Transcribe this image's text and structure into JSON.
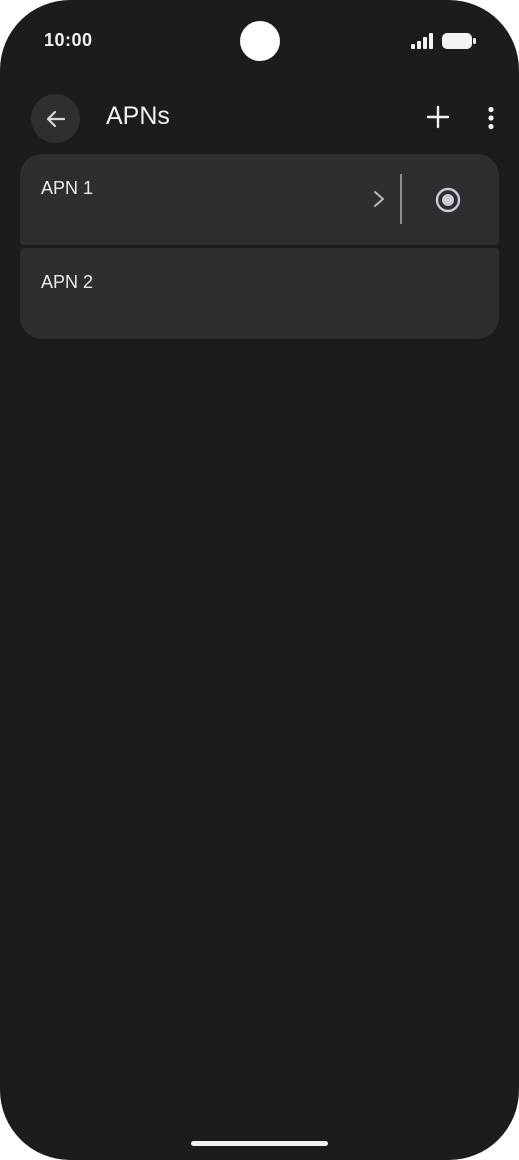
{
  "status_bar": {
    "time": "10:00"
  },
  "app_bar": {
    "title": "APNs",
    "back_icon": "arrow-back-icon",
    "add_icon": "plus-icon",
    "more_icon": "more-vert-icon"
  },
  "apn_list": [
    {
      "name": "APN 1",
      "selected": true,
      "has_details_chevron": true
    },
    {
      "name": "APN 2",
      "selected": false,
      "has_details_chevron": false
    }
  ],
  "colors": {
    "background": "#1c1c1e",
    "card": "#2e2e30",
    "text": "#ececee",
    "radio_selected": "#c9cbd9"
  }
}
